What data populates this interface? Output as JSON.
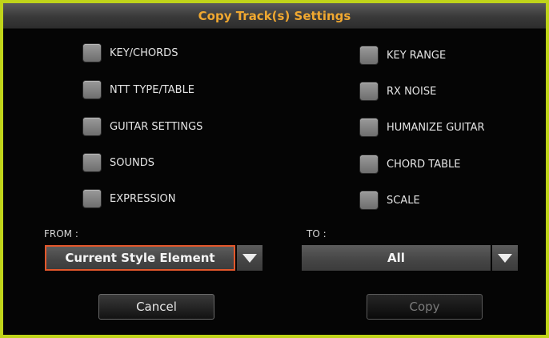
{
  "dialog": {
    "title": "Copy Track(s) Settings"
  },
  "options_left": [
    {
      "label": "KEY/CHORDS",
      "checked": false
    },
    {
      "label": "NTT TYPE/TABLE",
      "checked": false
    },
    {
      "label": "GUITAR SETTINGS",
      "checked": false
    },
    {
      "label": "SOUNDS",
      "checked": false
    },
    {
      "label": "EXPRESSION",
      "checked": false
    }
  ],
  "options_right": [
    {
      "label": "KEY RANGE",
      "checked": false
    },
    {
      "label": "RX NOISE",
      "checked": false
    },
    {
      "label": "HUMANIZE GUITAR",
      "checked": false
    },
    {
      "label": "CHORD TABLE",
      "checked": false
    },
    {
      "label": "SCALE",
      "checked": false
    }
  ],
  "from": {
    "label": "FROM :",
    "value": "Current Style Element"
  },
  "to": {
    "label": "TO :",
    "value": "All"
  },
  "buttons": {
    "cancel": "Cancel",
    "copy": "Copy"
  },
  "colors": {
    "frame": "#c0d41a",
    "title_text": "#f0a830",
    "focus_border": "#e3572b"
  },
  "icons": {
    "dropdown": "triangle-down-icon",
    "checkbox": "checkbox-unchecked-icon"
  }
}
